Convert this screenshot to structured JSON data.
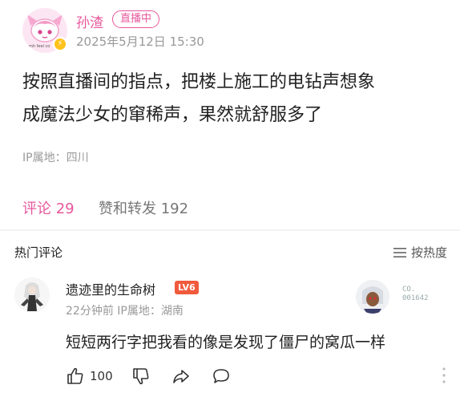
{
  "post": {
    "author": "孙渣",
    "live_badge": "直播中",
    "time": "2025年5月12日 15:30",
    "avatar_caption": "mh feel co",
    "body_lines": [
      "按照直播间的指点，把楼上施工的电钻声想象",
      "成魔法少女的窜稀声，果然就舒服多了"
    ],
    "ip": "IP属地：四川"
  },
  "tabs": [
    {
      "label": "评论 29",
      "active": true
    },
    {
      "label": "赞和转发 192",
      "active": false
    }
  ],
  "hot": {
    "title": "热门评论",
    "sort_label": "按热度"
  },
  "comment": {
    "user": "遗迹里的生命树",
    "level": "LV6",
    "meta": "22分钟前 IP属地：湖南",
    "text": "短短两行字把我看的像是发现了僵尸的窝瓜一样",
    "like_count": "100",
    "fan_card_line1": "CO.",
    "fan_card_line2": "001642"
  },
  "colors": {
    "accent": "#e8579b",
    "level_badge": "#f05a3c",
    "muted": "#999999"
  }
}
